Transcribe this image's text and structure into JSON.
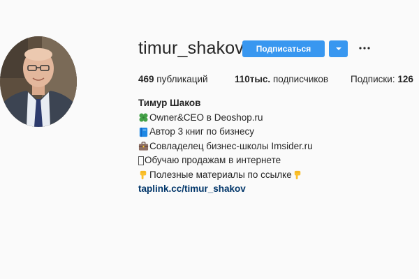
{
  "profile": {
    "username": "timur_shakov",
    "follow_label": "Подписаться"
  },
  "stats": {
    "posts_count": "469",
    "posts_label": " публикаций",
    "followers_count": "110тыс.",
    "followers_label": " подписчиков",
    "following_label": "Подписки: ",
    "following_count": "126"
  },
  "bio": {
    "full_name": "Тимур Шаков",
    "lines": [
      {
        "icon": "four-leaf-clover-icon",
        "text": "Owner&CEO в Deoshop.ru"
      },
      {
        "icon": "blue-book-icon",
        "text": "Автор 3 книг по бизнесу"
      },
      {
        "icon": "briefcase-icon",
        "text": "Совладелец бизнес-школы Imsider.ru"
      },
      {
        "icon": "missing-glyph-icon",
        "text": "Обучаю продажам в интернете"
      },
      {
        "icon": "pointing-down-icon",
        "text": "Полезные материалы по ссылке"
      }
    ],
    "link": "taplink.cc/timur_shakov"
  },
  "colors": {
    "accent": "#3897f0",
    "link": "#003569",
    "background": "#fafafa"
  }
}
